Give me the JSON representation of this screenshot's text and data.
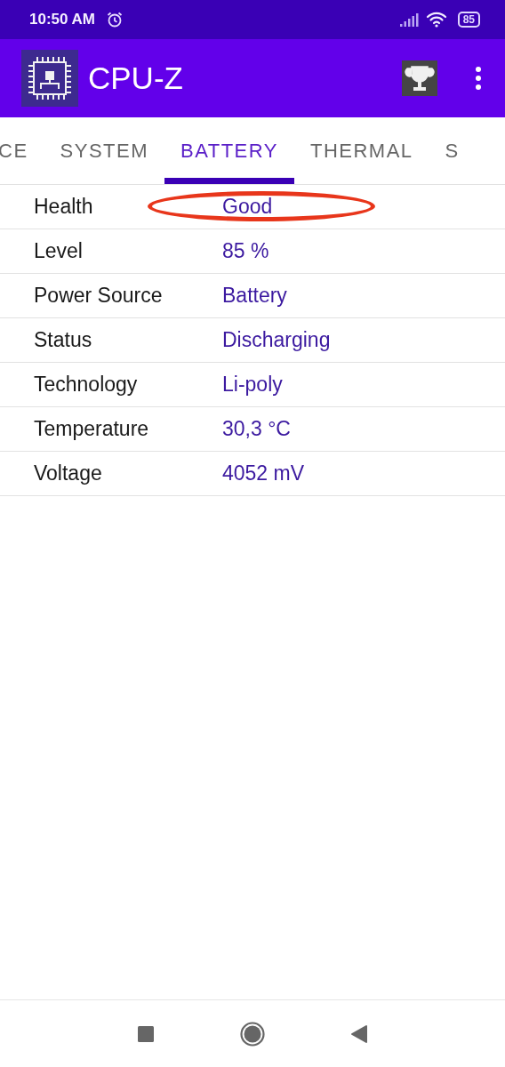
{
  "status_bar": {
    "time": "10:50 AM",
    "battery": "85"
  },
  "app_bar": {
    "title": "CPU-Z"
  },
  "tabs": [
    {
      "label": "CE",
      "selected": false
    },
    {
      "label": "SYSTEM",
      "selected": false
    },
    {
      "label": "BATTERY",
      "selected": true
    },
    {
      "label": "THERMAL",
      "selected": false
    },
    {
      "label": "S",
      "selected": false
    }
  ],
  "rows": [
    {
      "label": "Health",
      "value": "Good",
      "circled": true
    },
    {
      "label": "Level",
      "value": "85 %",
      "circled": false
    },
    {
      "label": "Power Source",
      "value": "Battery",
      "circled": false
    },
    {
      "label": "Status",
      "value": "Discharging",
      "circled": false
    },
    {
      "label": "Technology",
      "value": "Li-poly",
      "circled": false
    },
    {
      "label": "Temperature",
      "value": "30,3 °C",
      "circled": false
    },
    {
      "label": "Voltage",
      "value": "4052 mV",
      "circled": false
    }
  ]
}
